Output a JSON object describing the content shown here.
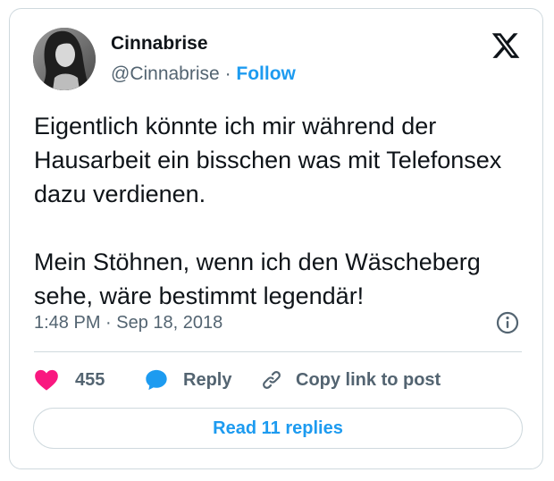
{
  "author": {
    "display_name": "Cinnabrise",
    "handle": "@Cinnabrise",
    "separator": "·",
    "follow_label": "Follow",
    "avatar": "profile-photo"
  },
  "brand": {
    "logo": "x-logo-icon"
  },
  "tweet": {
    "paragraph_1": "Eigentlich könnte ich mir während der Hausarbeit ein bisschen was mit Telefonsex dazu verdienen.",
    "paragraph_2": "Mein Stöhnen, wenn ich den Wäscheberg sehe, wäre bestimmt legendär!",
    "timestamp": "1:48 PM · Sep 18, 2018"
  },
  "actions": {
    "like_count": "455",
    "reply_label": "Reply",
    "copy_link_label": "Copy link to post"
  },
  "replies_button": {
    "label": "Read 11 replies"
  },
  "colors": {
    "accent": "#1d9bf0",
    "like": "#f91880",
    "text": "#0f1419",
    "muted": "#536471",
    "border": "#cfd9de"
  }
}
